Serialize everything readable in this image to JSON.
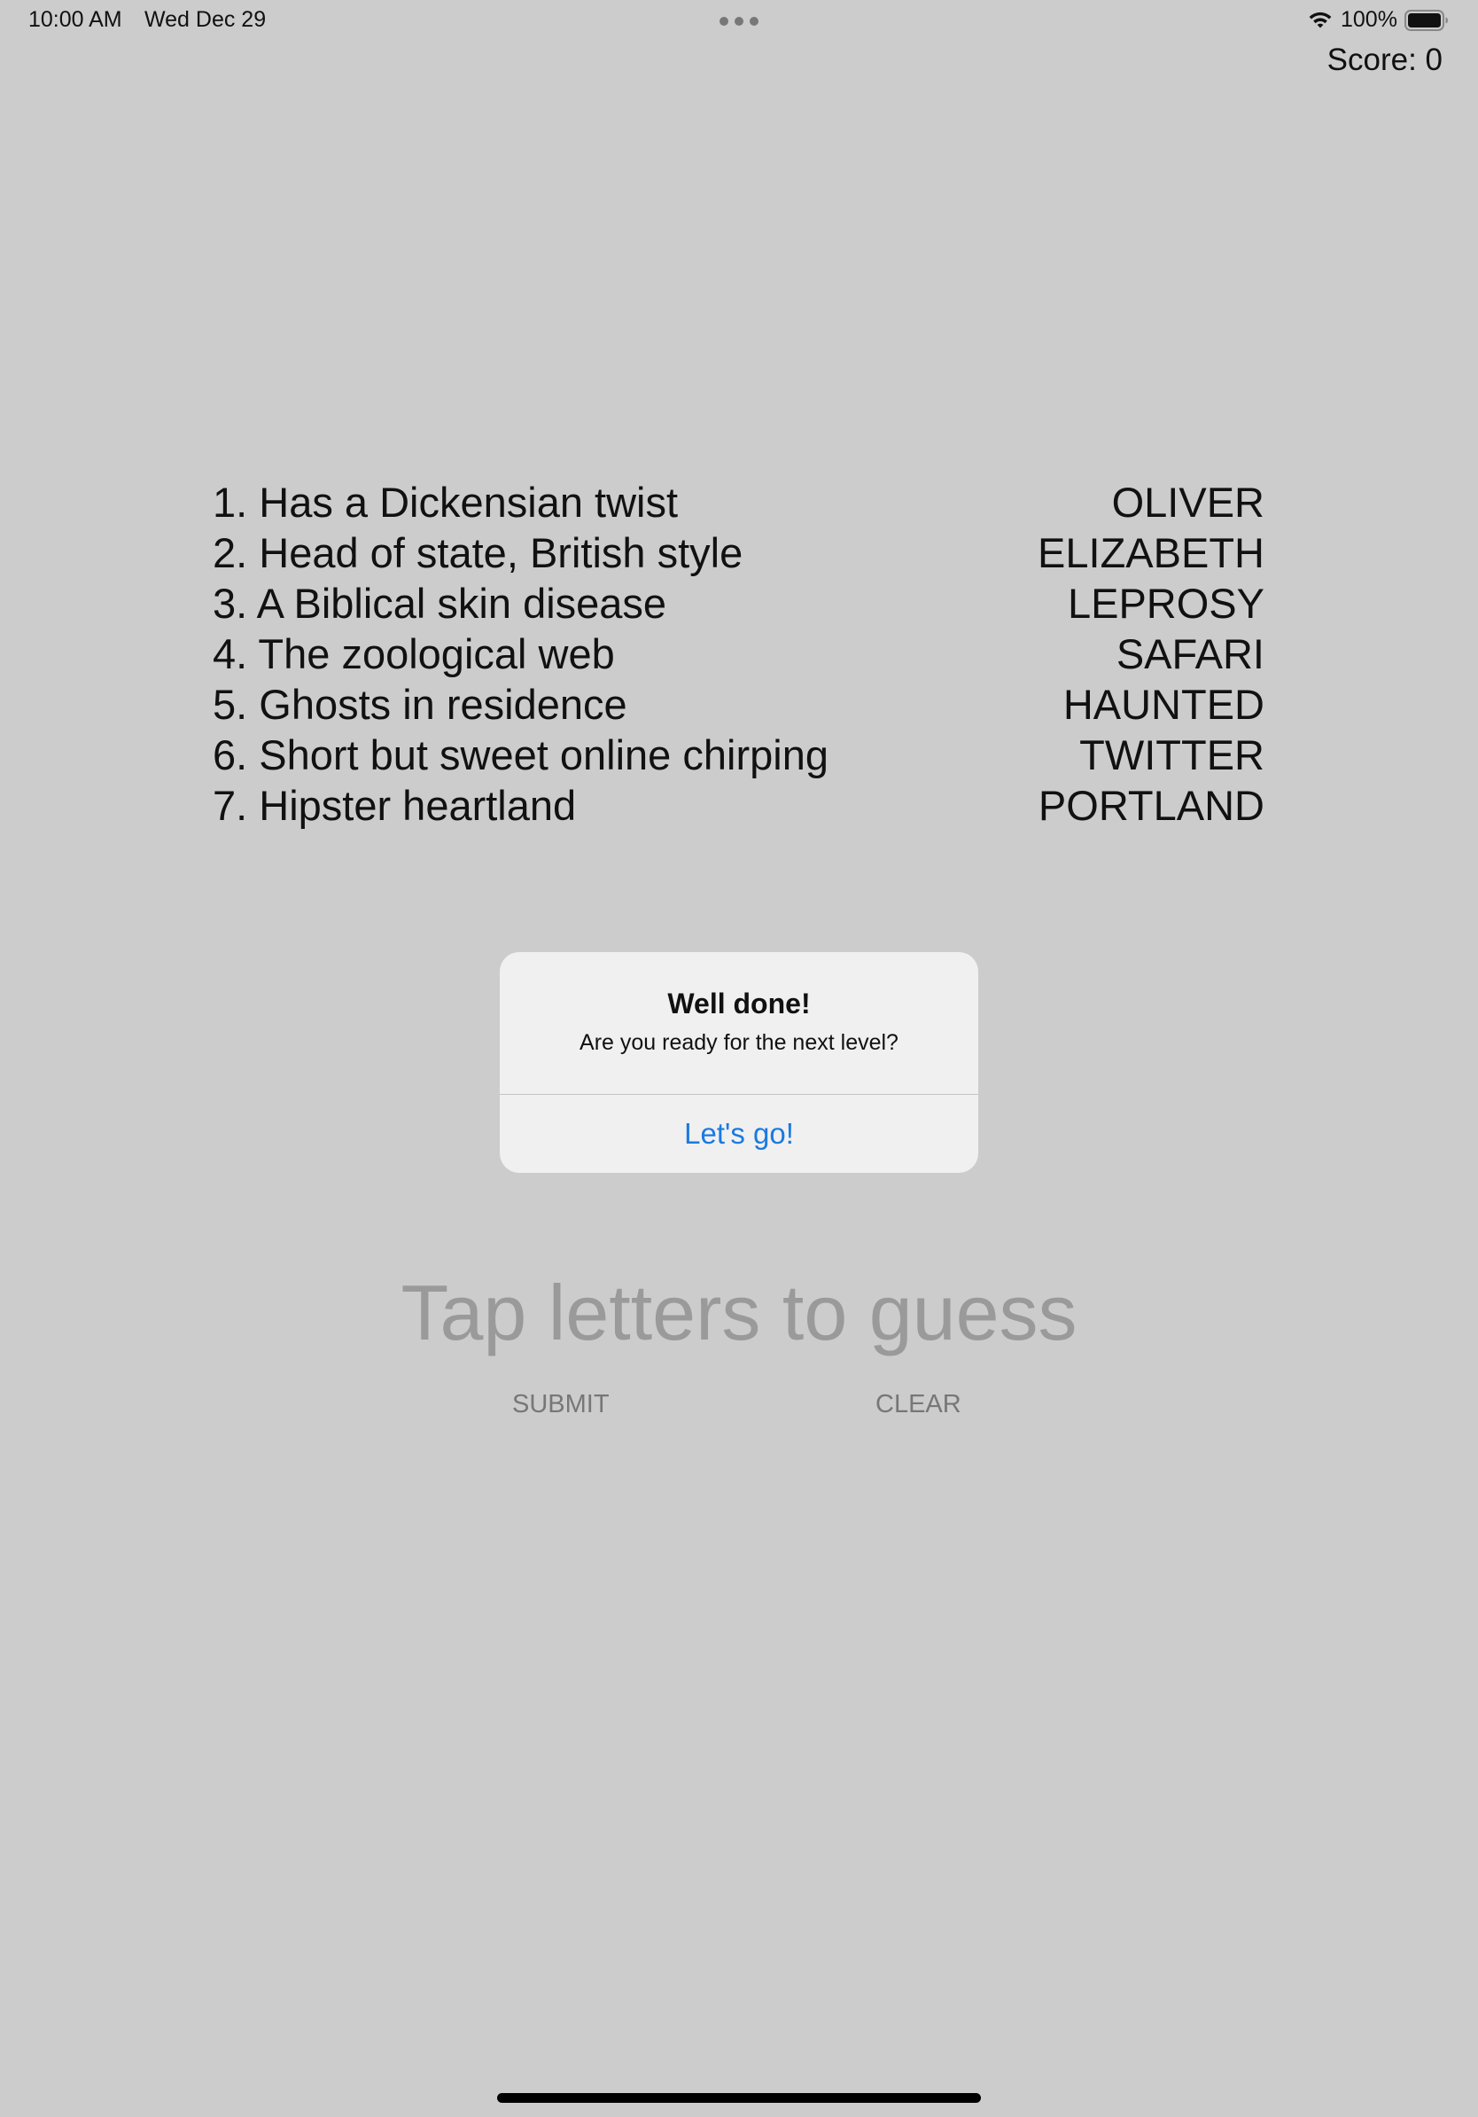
{
  "status_bar": {
    "time": "10:00 AM",
    "date": "Wed Dec 29",
    "battery_percent": "100%",
    "battery_level": 1.0
  },
  "score": "Score: 0",
  "clues": [
    {
      "clue": "1. Has a Dickensian twist",
      "answer": "OLIVER"
    },
    {
      "clue": "2. Head of state, British style",
      "answer": "ELIZABETH"
    },
    {
      "clue": "3. A Biblical skin disease",
      "answer": "LEPROSY"
    },
    {
      "clue": "4. The zoological web",
      "answer": "SAFARI"
    },
    {
      "clue": "5. Ghosts in residence",
      "answer": "HAUNTED"
    },
    {
      "clue": "6. Short but sweet online chirping",
      "answer": "TWITTER"
    },
    {
      "clue": "7. Hipster heartland",
      "answer": "PORTLAND"
    }
  ],
  "alert": {
    "title": "Well done!",
    "message": "Are you ready for the next level?",
    "button_label": "Let's go!"
  },
  "guess": {
    "placeholder": "Tap letters to guess"
  },
  "buttons": {
    "submit": "SUBMIT",
    "clear": "CLEAR"
  },
  "colors": {
    "background": "#cccccc",
    "alert_background": "#f0f0f0",
    "accent": "#1a7ae0"
  },
  "icons": {
    "wifi": "wifi-icon",
    "battery": "battery-icon",
    "multitask": "more-dots-icon"
  }
}
